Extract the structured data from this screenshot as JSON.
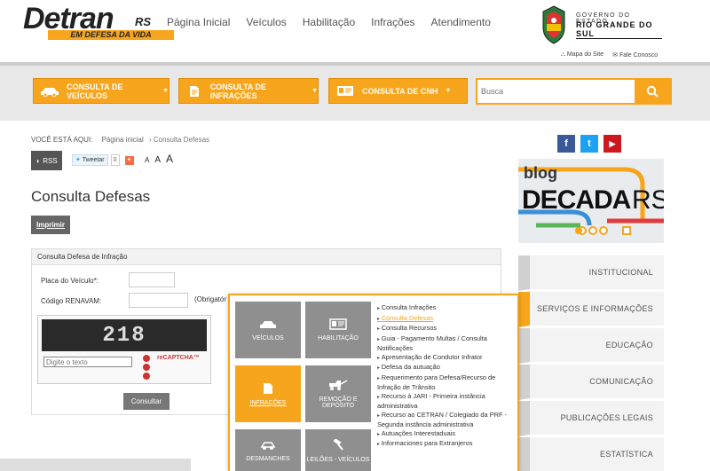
{
  "logo": {
    "main": "Detran",
    "suffix": "RS",
    "tagline": "EM DEFESA DA VIDA"
  },
  "topnav": [
    "Página Inicial",
    "Veículos",
    "Habilitação",
    "Infrações",
    "Atendimento"
  ],
  "gov": {
    "line1": "GOVERNO DO ESTADO",
    "line2": "RIO GRANDE DO SUL"
  },
  "sublinks": {
    "map": "Mapa do Site",
    "contact": "Fale Conosco"
  },
  "bar": {
    "veiculos": "CONSULTA DE VEÍCULOS",
    "infracoes": "CONSULTA DE INFRAÇÕES",
    "cnh": "CONSULTA DE CNH",
    "search_placeholder": "Busca"
  },
  "breadcrumb": {
    "you": "VOCÊ ESTÁ AQUI:",
    "home": "Página inicial",
    "sep": "›",
    "current": "Consulta Defesas"
  },
  "share": {
    "rss": "RSS",
    "tweet": "Tweetar",
    "count": "0",
    "plus": "+"
  },
  "fontsize": {
    "a1": "A",
    "a2": "A",
    "a3": "A"
  },
  "page_title": "Consulta Defesas",
  "print": "Imprimir",
  "form": {
    "header": "Consulta Defesa de Infração",
    "placa_label": "Placa do Veículo*:",
    "renavam_label": "Código RENAVAM:",
    "renavam_note": "(Obrigatór",
    "captcha_text": "218",
    "captcha_placeholder": "Digite o texto",
    "captcha_brand": "reCAPTCHA™",
    "submit": "Consultar"
  },
  "mega": {
    "tiles": [
      "VEÍCULOS",
      "HABILITAÇÃO",
      "INFRAÇÕES",
      "REMOÇÃO E DEPÓSITO",
      "DESMANCHES",
      "LEILÕES - VEÍCULOS"
    ],
    "links": [
      "Consulta Infrações",
      "Consulta Defesas",
      "Consulta Recursos",
      "Guia - Pagamento Multas / Consulta Notificações",
      "Apresentação de Condutor Infrator",
      "Defesa da autuação",
      "Requerimento para Defesa/Recurso de Infração de Trânsito",
      "Recurso à JARI - Primeira instância administrativa",
      "Recurso ao CETRAN / Colegiado da PRF - Segunda instância administrativa",
      "Autuações Interestaduais",
      "Informaciones para Extranjeros"
    ]
  },
  "social": {
    "facebook": "f",
    "twitter": "t",
    "youtube": "▶"
  },
  "blog": {
    "top": "blog",
    "main": "DECADA",
    "rs": "RS"
  },
  "sidebar": [
    "INSTITUCIONAL",
    "SERVIÇOS E INFORMAÇÕES",
    "EDUCAÇÃO",
    "COMUNICAÇÃO",
    "PUBLICAÇÕES LEGAIS",
    "ESTATÍSTICA"
  ],
  "colors": {
    "accent": "#f7a51c",
    "gray_tile": "#8f8f8f",
    "facebook": "#3b5998",
    "twitter": "#1da1f2",
    "youtube": "#cc181e"
  }
}
